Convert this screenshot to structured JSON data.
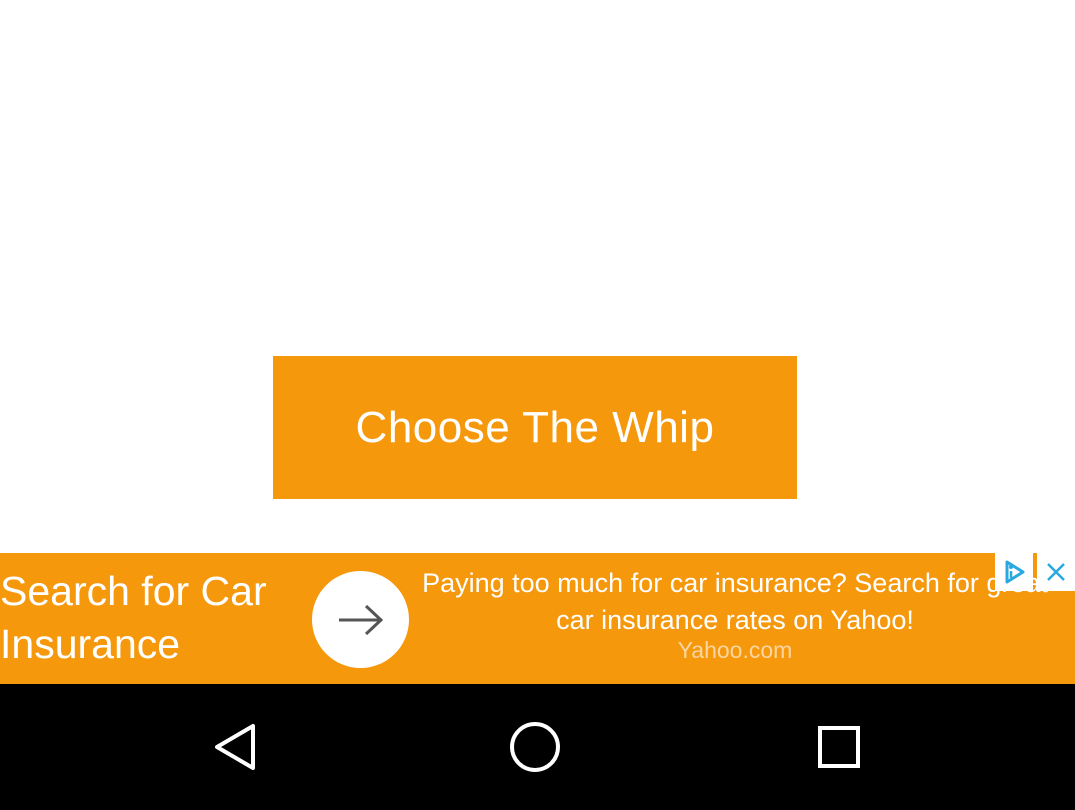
{
  "main": {
    "choose_button_label": "Choose The Whip"
  },
  "ad": {
    "headline": "Search for Car\nInsurance",
    "body": "Paying too much for car insurance? Search for great car insurance rates on Yahoo!",
    "source": "Yahoo.com",
    "background_color": "#f6980b",
    "adchoices_icon": "adchoices-icon",
    "close_icon": "close-icon",
    "arrow_icon": "arrow-right-icon"
  },
  "navigation": {
    "back_icon": "back-icon",
    "home_icon": "home-icon",
    "recent_icon": "recent-apps-icon"
  }
}
